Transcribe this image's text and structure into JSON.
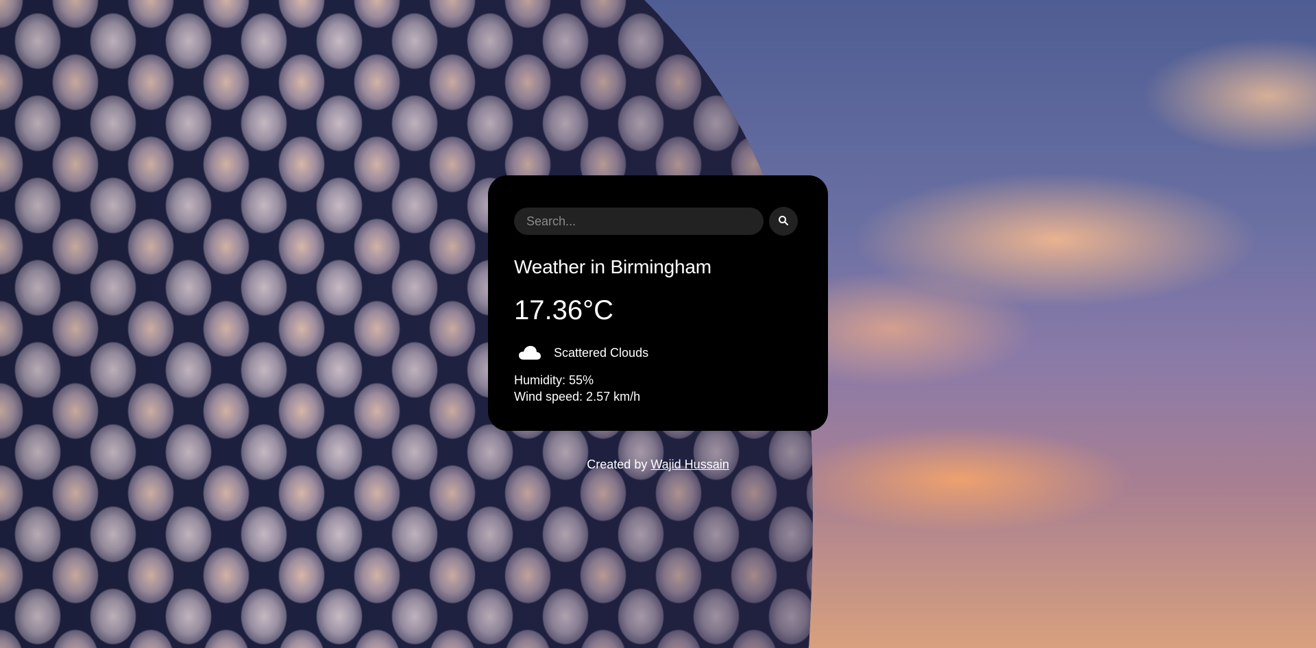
{
  "search": {
    "placeholder": "Search...",
    "button_icon": "search-icon"
  },
  "weather": {
    "city_title": "Weather in Birmingham",
    "temperature": "17.36°C",
    "condition_icon": "cloud-icon",
    "description": "Scattered Clouds",
    "humidity": "Humidity: 55%",
    "wind": "Wind speed: 2.57 km/h"
  },
  "footer": {
    "prefix": "Created by ",
    "author": "Wajid Hussain"
  },
  "colors": {
    "card_background": "#000000",
    "input_background": "#222222",
    "text": "#ffffff"
  }
}
